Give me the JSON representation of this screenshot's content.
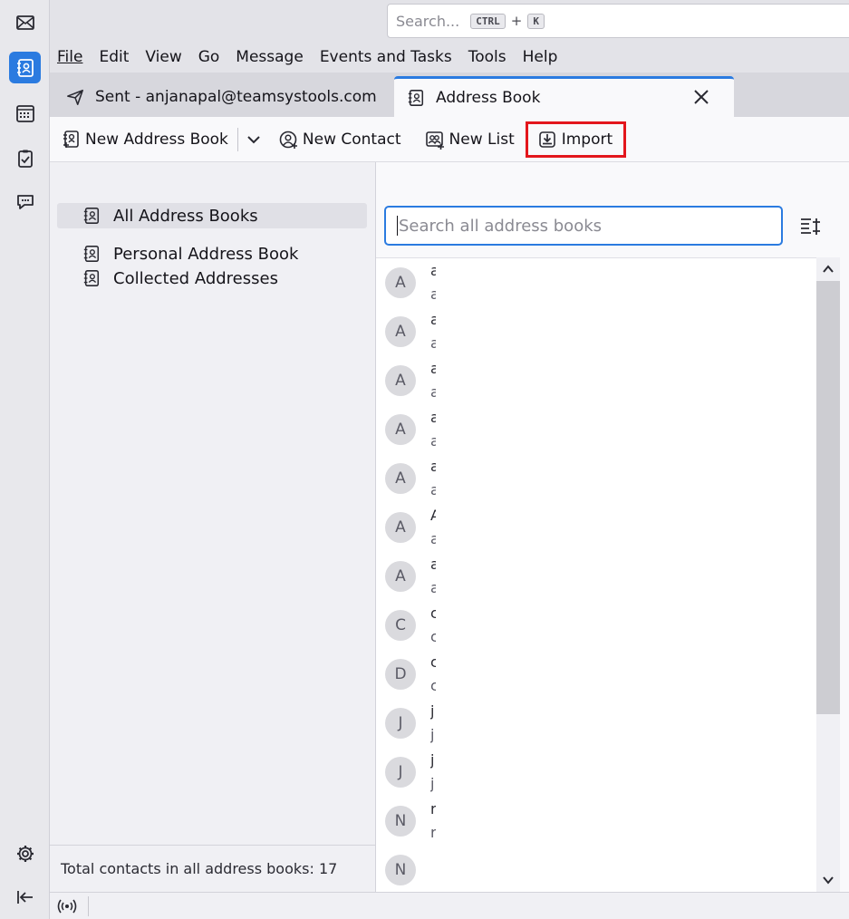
{
  "spaces": [
    {
      "name": "mail-icon",
      "active": false
    },
    {
      "name": "address-book-icon",
      "active": true
    },
    {
      "name": "calendar-icon",
      "active": false
    },
    {
      "name": "tasks-icon",
      "active": false
    },
    {
      "name": "chat-icon",
      "active": false
    }
  ],
  "global_search": {
    "placeholder": "Search...",
    "key1": "CTRL",
    "plus": "+",
    "key2": "K"
  },
  "menu": {
    "file": "File",
    "edit": "Edit",
    "view": "View",
    "go": "Go",
    "message": "Message",
    "events": "Events and Tasks",
    "tools": "Tools",
    "help": "Help"
  },
  "tabs": {
    "sent": "Sent - anjanapal@teamsystools.com",
    "address_book": "Address Book"
  },
  "toolbar": {
    "new_address_book": "New Address Book",
    "new_contact": "New Contact",
    "new_list": "New List",
    "import": "Import"
  },
  "books": {
    "all": "All Address Books",
    "personal": "Personal Address Book",
    "collected": "Collected Addresses",
    "footer": "Total contacts in all address books: 17"
  },
  "contacts": {
    "search_placeholder": "Search all address books",
    "rows": [
      {
        "initial": "A",
        "l1": "a",
        "l2": "a"
      },
      {
        "initial": "A",
        "l1": "a",
        "l2": "a"
      },
      {
        "initial": "A",
        "l1": "a",
        "l2": "a"
      },
      {
        "initial": "A",
        "l1": "a",
        "l2": "a"
      },
      {
        "initial": "A",
        "l1": "a",
        "l2": "a"
      },
      {
        "initial": "A",
        "l1": "A",
        "l2": "a"
      },
      {
        "initial": "A",
        "l1": "a",
        "l2": "a"
      },
      {
        "initial": "C",
        "l1": "c",
        "l2": "c"
      },
      {
        "initial": "D",
        "l1": "c",
        "l2": "c"
      },
      {
        "initial": "J",
        "l1": "j",
        "l2": "j"
      },
      {
        "initial": "J",
        "l1": "j",
        "l2": "j"
      },
      {
        "initial": "N",
        "l1": "r",
        "l2": "r"
      },
      {
        "initial": "N",
        "l1": "",
        "l2": ""
      }
    ]
  },
  "colors": {
    "accent": "#2b7be0",
    "highlight": "#e3161c"
  }
}
